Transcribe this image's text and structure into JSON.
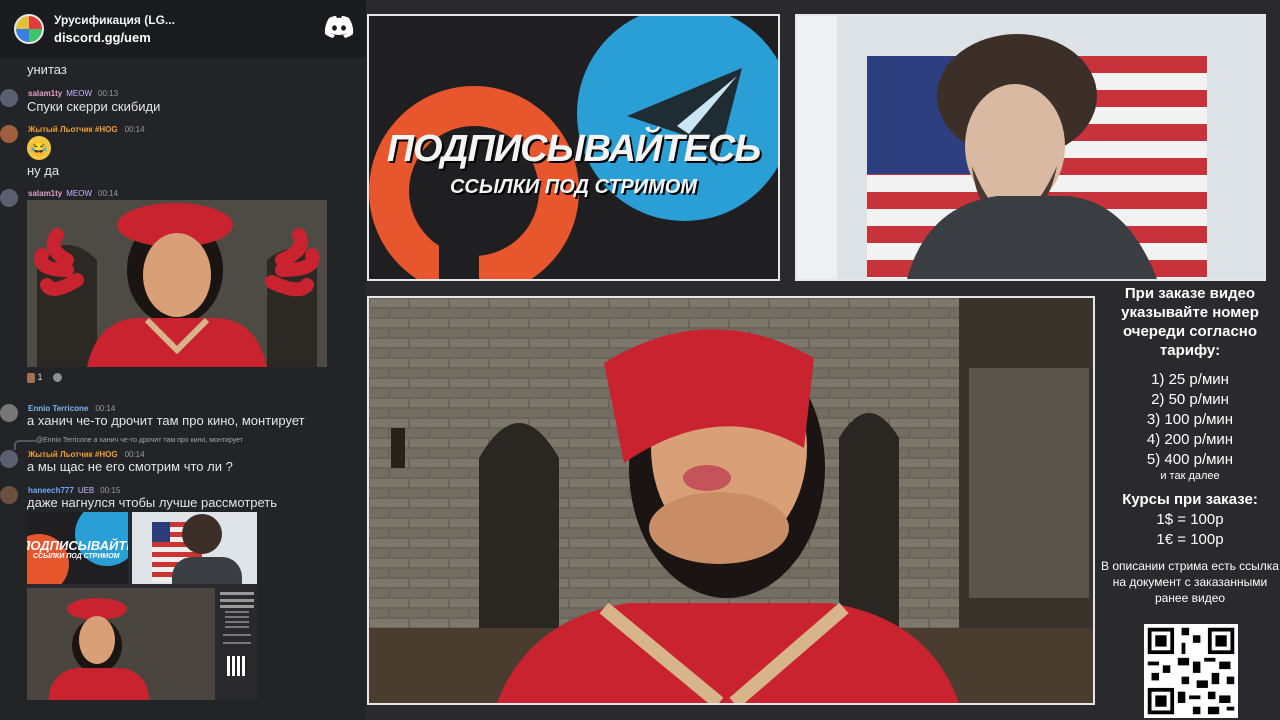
{
  "chat": {
    "server_name": "Урусификация (LG...",
    "server_invite": "discord.gg/uem",
    "messages": [
      {
        "text": "унитаз"
      },
      {
        "user": "salam1ty",
        "badge": "MEOW",
        "time": "00:13",
        "text": "Спуки скерри скибиди"
      },
      {
        "user": "Жытый Льотчик #HOG",
        "time": "00:14",
        "text": "ну да"
      },
      {
        "user": "salam1ty",
        "badge": "MEOW",
        "time": "00:14",
        "reaction_count": "1"
      },
      {
        "user": "Ennio Terricone",
        "time": "00:14",
        "text": "а ханич че-то дрочит там про кино, монтирует"
      },
      {
        "reply": "@Ennio Terricone а ханич че-то дрочит там про кино, монтирует",
        "user": "Жытый Льотчик #HOG",
        "time": "00:14",
        "text": "а мы щас не его смотрим что ли ?"
      },
      {
        "user": "haneech777",
        "badge": "UEB",
        "time": "00:15",
        "text": "даже нагнулся чтобы лучше рассмотреть"
      }
    ],
    "thumb_promo_title": "ПОДПИСЫВАЙТЕСЬ",
    "thumb_promo_sub": "ССЫЛКИ ПОД СТРИМОМ"
  },
  "promo": {
    "title": "ПОДПИСЫВАЙТЕСЬ",
    "subtitle": "ССЫЛКИ ПОД СТРИМОМ"
  },
  "info": {
    "intro": "При заказе видео указывайте номер очереди согласно тарифу:",
    "tariffs": [
      "1) 25 р/мин",
      "2) 50 р/мин",
      "3) 100 р/мин",
      "4) 200 р/мин",
      "5) 400 р/мин"
    ],
    "tariffs_more": "и так далее",
    "course_title": "Курсы при заказе:",
    "courses": [
      "1$ = 100р",
      "1€ = 100р"
    ],
    "archive_note": "В описании стрима есть ссылка на документ с заказанными ранее видео"
  },
  "colors": {
    "patreon": "#e8562e",
    "telegram": "#2a9fd6",
    "costume_red": "#c8232e",
    "discord_blurple": "#5865f2"
  }
}
